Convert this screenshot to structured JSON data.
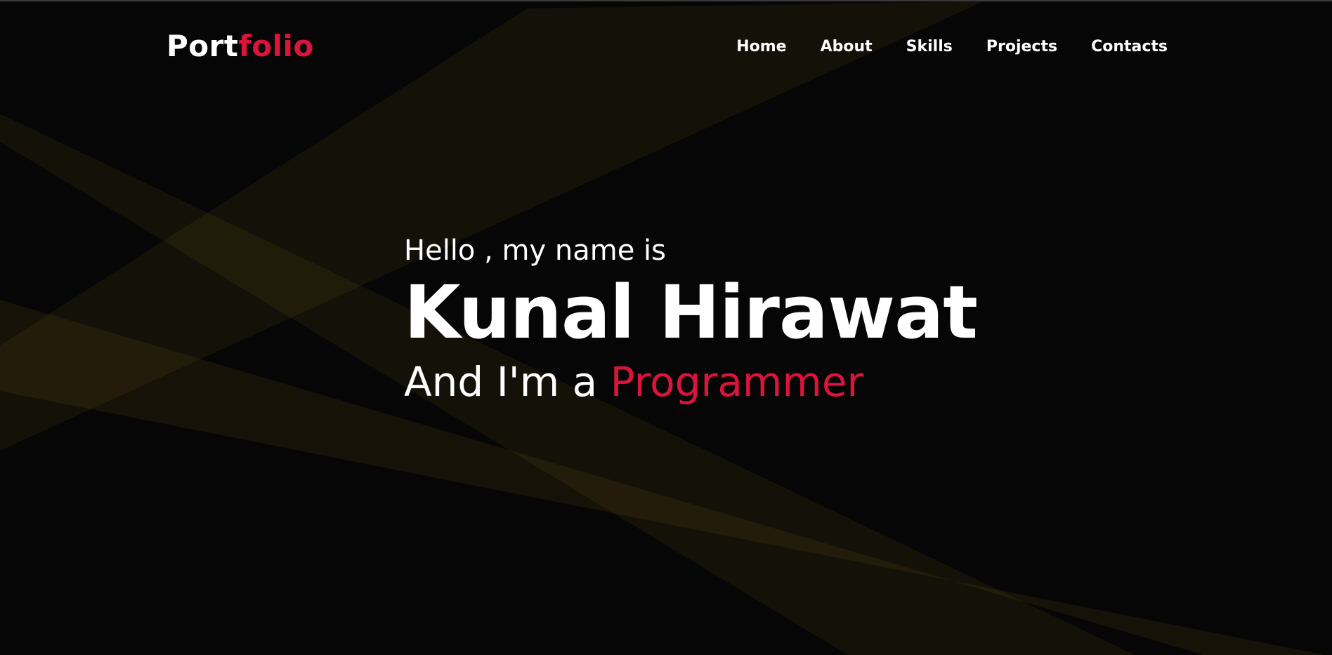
{
  "brand": {
    "logo_main": "Port",
    "logo_accent": "folio"
  },
  "nav": {
    "items": [
      {
        "label": "Home"
      },
      {
        "label": "About"
      },
      {
        "label": "Skills"
      },
      {
        "label": "Projects"
      },
      {
        "label": "Contacts"
      }
    ]
  },
  "hero": {
    "greeting": "Hello , my name is",
    "name": "Kunal Hirawat",
    "role_prefix": "And I'm a ",
    "role_highlight": "Programmer"
  },
  "colors": {
    "background": "#060606",
    "accent": "#dc143c",
    "text": "#ffffff",
    "beam": "#3a2e0e"
  }
}
